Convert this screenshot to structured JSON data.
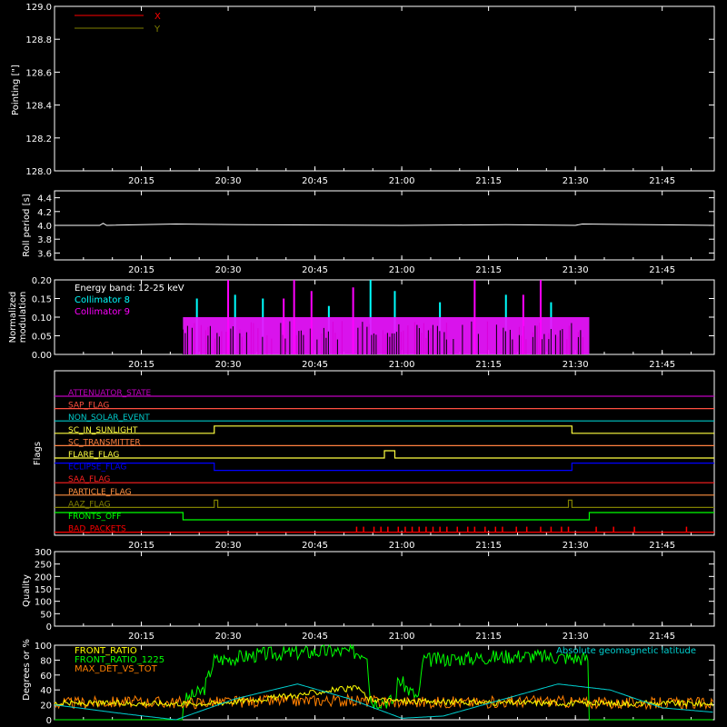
{
  "time_ticks": [
    "20:15",
    "20:30",
    "20:45",
    "21:00",
    "21:15",
    "21:30",
    "21:45"
  ],
  "time_range": [
    20.0,
    21.9
  ],
  "chart_data": [
    {
      "type": "line",
      "id": "pointing",
      "ylabel": "Pointing [\"]",
      "ylim": [
        128.0,
        129.0
      ],
      "yticks": [
        "128.0",
        "128.2",
        "128.4",
        "128.6",
        "128.8",
        "129.0"
      ],
      "series": [
        {
          "name": "X",
          "color": "#ff0000",
          "t": [],
          "values": []
        },
        {
          "name": "Y",
          "color": "#808000",
          "t": [],
          "values": []
        }
      ],
      "legend": "top-left"
    },
    {
      "type": "line",
      "id": "roll",
      "ylabel": "Roll period [s]",
      "ylim": [
        3.5,
        4.5
      ],
      "yticks": [
        "3.6",
        "3.8",
        "4.0",
        "4.2",
        "4.4"
      ],
      "series": [
        {
          "color": "#ffffff",
          "t": [
            20.0,
            20.13,
            20.14,
            20.15,
            20.35,
            20.55,
            21.0,
            21.3,
            21.5,
            21.52,
            21.9
          ],
          "values": [
            4.0,
            4.0,
            4.03,
            4.0,
            4.02,
            4.01,
            4.0,
            4.01,
            4.0,
            4.02,
            4.0
          ]
        }
      ]
    },
    {
      "type": "bar",
      "id": "modulation",
      "ylabel": "Normalized modulation",
      "ylim": [
        0.0,
        0.2
      ],
      "yticks": [
        "0.00",
        "0.05",
        "0.10",
        "0.15",
        "0.20"
      ],
      "annotation": "Energy band: 12-25 keV",
      "series": [
        {
          "name": "Collimator 8",
          "color": "#00ffff",
          "band": [
            20.37,
            21.54
          ],
          "base": 0.1,
          "spikes": [
            [
              20.41,
              0.15
            ],
            [
              20.52,
              0.16
            ],
            [
              20.6,
              0.15
            ],
            [
              20.79,
              0.13
            ],
            [
              20.91,
              0.2
            ],
            [
              20.98,
              0.17
            ],
            [
              21.11,
              0.14
            ],
            [
              21.3,
              0.16
            ],
            [
              21.43,
              0.14
            ]
          ]
        },
        {
          "name": "Collimator 9",
          "color": "#ff00ff",
          "band": [
            20.37,
            21.54
          ],
          "base": 0.1,
          "spikes": [
            [
              20.5,
              0.2
            ],
            [
              20.66,
              0.15
            ],
            [
              20.69,
              0.2
            ],
            [
              20.74,
              0.17
            ],
            [
              20.86,
              0.18
            ],
            [
              21.21,
              0.2
            ],
            [
              21.35,
              0.16
            ],
            [
              21.4,
              0.2
            ]
          ]
        }
      ]
    },
    {
      "type": "line",
      "id": "flags",
      "ylabel": "Flags",
      "series": [
        {
          "name": "ATTENUATOR_STATE",
          "color": "#c000c0",
          "t": [
            20.0,
            21.9
          ],
          "values": [
            0,
            0
          ]
        },
        {
          "name": "SAP_FLAG",
          "color": "#ff5040",
          "t": [
            20.0,
            21.9
          ],
          "values": [
            0,
            0
          ]
        },
        {
          "name": "NON_SOLAR_EVENT",
          "color": "#00c8c8",
          "t": [
            20.0,
            21.9
          ],
          "values": [
            0,
            0
          ]
        },
        {
          "name": "SC_IN_SUNLIGHT",
          "color": "#ffff40",
          "t": [
            20.0,
            20.46,
            20.46,
            21.49,
            21.49,
            21.9
          ],
          "values": [
            0,
            0,
            1,
            1,
            0,
            0
          ]
        },
        {
          "name": "SC_TRANSMITTER",
          "color": "#ff8040",
          "t": [
            20.0,
            21.9
          ],
          "values": [
            0,
            0
          ]
        },
        {
          "name": "FLARE_FLAG",
          "color": "#ffff40",
          "t": [
            20.0,
            20.95,
            20.95,
            20.98,
            20.98,
            21.9
          ],
          "values": [
            0,
            0,
            1,
            1,
            0,
            0
          ]
        },
        {
          "name": "ECLIPSE_FLAG",
          "color": "#0000ff",
          "t": [
            20.0,
            20.46,
            20.46,
            21.49,
            21.49,
            21.9
          ],
          "values": [
            1,
            1,
            0,
            0,
            1,
            1
          ]
        },
        {
          "name": "SAA_FLAG",
          "color": "#ff2020",
          "t": [
            20.0,
            21.9
          ],
          "values": [
            0,
            0
          ]
        },
        {
          "name": "PARTICLE_FLAG",
          "color": "#ff9040",
          "t": [
            20.0,
            21.9
          ],
          "values": [
            0,
            0
          ]
        },
        {
          "name": "AAZ_FLAG",
          "color": "#808000",
          "t": [
            20.0,
            20.46,
            20.46,
            20.47,
            20.47,
            21.48,
            21.48,
            21.49,
            21.49,
            21.9
          ],
          "values": [
            0,
            0,
            1,
            1,
            0,
            0,
            1,
            1,
            0,
            0
          ]
        },
        {
          "name": "FRONTS_OFF",
          "color": "#00ff00",
          "t": [
            20.0,
            20.37,
            20.37,
            21.54,
            21.54,
            21.9
          ],
          "values": [
            1,
            1,
            0,
            0,
            1,
            1
          ]
        },
        {
          "name": "BAD_PACKETS",
          "color": "#ff0000",
          "t": [
            20.0,
            21.9
          ],
          "values": [
            0,
            0
          ],
          "ticks": [
            20.87,
            20.89,
            20.92,
            20.94,
            20.96,
            20.99,
            21.01,
            21.03,
            21.05,
            21.07,
            21.09,
            21.11,
            21.13,
            21.16,
            21.19,
            21.21,
            21.24,
            21.27,
            21.29,
            21.33,
            21.36,
            21.4,
            21.43,
            21.46,
            21.48,
            21.56,
            21.61,
            21.67,
            21.82
          ]
        }
      ]
    },
    {
      "type": "line",
      "id": "quality",
      "ylabel": "Quality",
      "ylim": [
        0,
        300
      ],
      "yticks": [
        "0",
        "50",
        "100",
        "150",
        "200",
        "250",
        "300"
      ],
      "series": []
    },
    {
      "type": "line",
      "id": "ratios",
      "ylabel": "Degrees or %",
      "ylim": [
        0,
        100
      ],
      "yticks": [
        "0",
        "20",
        "40",
        "60",
        "80",
        "100"
      ],
      "series": [
        {
          "name": "FRONT_RATIO",
          "color": "#ffff00",
          "t": [
            20.0,
            20.46,
            20.6,
            20.7,
            20.8,
            20.88,
            20.9,
            21.0,
            21.1,
            21.3,
            21.55,
            21.9
          ],
          "values": [
            22,
            22,
            28,
            33,
            40,
            42,
            28,
            25,
            24,
            23,
            22,
            22
          ]
        },
        {
          "name": "FRONT_RATIO_1225",
          "color": "#00ff00",
          "t": [
            20.0,
            20.37,
            20.37,
            20.43,
            20.46,
            20.5,
            20.6,
            20.7,
            20.8,
            20.9,
            20.91,
            20.98,
            20.99,
            21.02,
            21.05,
            21.06,
            21.15,
            21.25,
            21.35,
            21.45,
            21.54,
            21.54,
            21.9
          ],
          "values": [
            0,
            0,
            25,
            40,
            80,
            82,
            88,
            90,
            92,
            90,
            25,
            25,
            55,
            40,
            28,
            80,
            82,
            84,
            86,
            84,
            82,
            0,
            0
          ]
        },
        {
          "name": "MAX_DET_VS_TOT",
          "color": "#ff8000",
          "t": [
            20.0,
            20.2,
            20.4,
            20.6,
            20.8,
            21.0,
            21.2,
            21.4,
            21.6,
            21.9
          ],
          "values": [
            22,
            24,
            23,
            25,
            26,
            24,
            23,
            25,
            22,
            22
          ]
        },
        {
          "name": "Absolute geomagnetic latitude",
          "color": "#00d0d0",
          "t": [
            20.0,
            20.2,
            20.35,
            20.52,
            20.7,
            20.85,
            21.0,
            21.12,
            21.25,
            21.45,
            21.6,
            21.75,
            21.9
          ],
          "values": [
            20,
            8,
            0,
            28,
            48,
            28,
            2,
            5,
            22,
            48,
            40,
            16,
            10
          ]
        }
      ],
      "legend": "top-left"
    }
  ]
}
